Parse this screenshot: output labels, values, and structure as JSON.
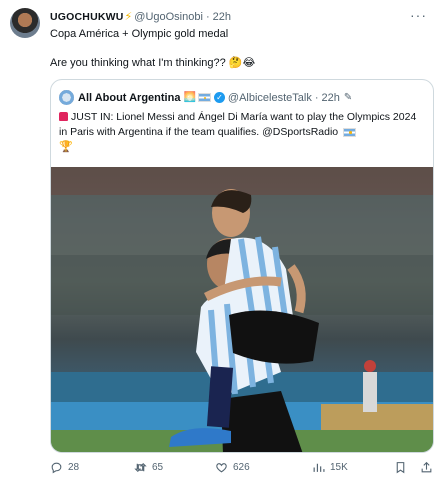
{
  "tweet": {
    "author": {
      "display_name": "UGOCHUKWU",
      "badge_emoji": "⚡",
      "handle": "@UgoOsinobi",
      "time": "22h"
    },
    "text_line1": "Copa América + Olympic gold medal",
    "text_line2": "Are you thinking what I'm thinking?? 🤔😂"
  },
  "quote": {
    "author": {
      "display_name": "All About Argentina",
      "emoji": "🌅",
      "handle": "@AlbicelesteTalk",
      "time": "22h"
    },
    "text": "JUST IN: Lionel Messi and Ángel Di María want to play the Olympics 2024 in Paris with Argentina if the team qualifies. @DSportsRadio"
  },
  "actions": {
    "replies": "28",
    "retweets": "65",
    "likes": "626",
    "views": "15K"
  },
  "colors": {
    "muted": "#536471",
    "verified": "#1d9bf0",
    "border": "#cfd9de"
  }
}
